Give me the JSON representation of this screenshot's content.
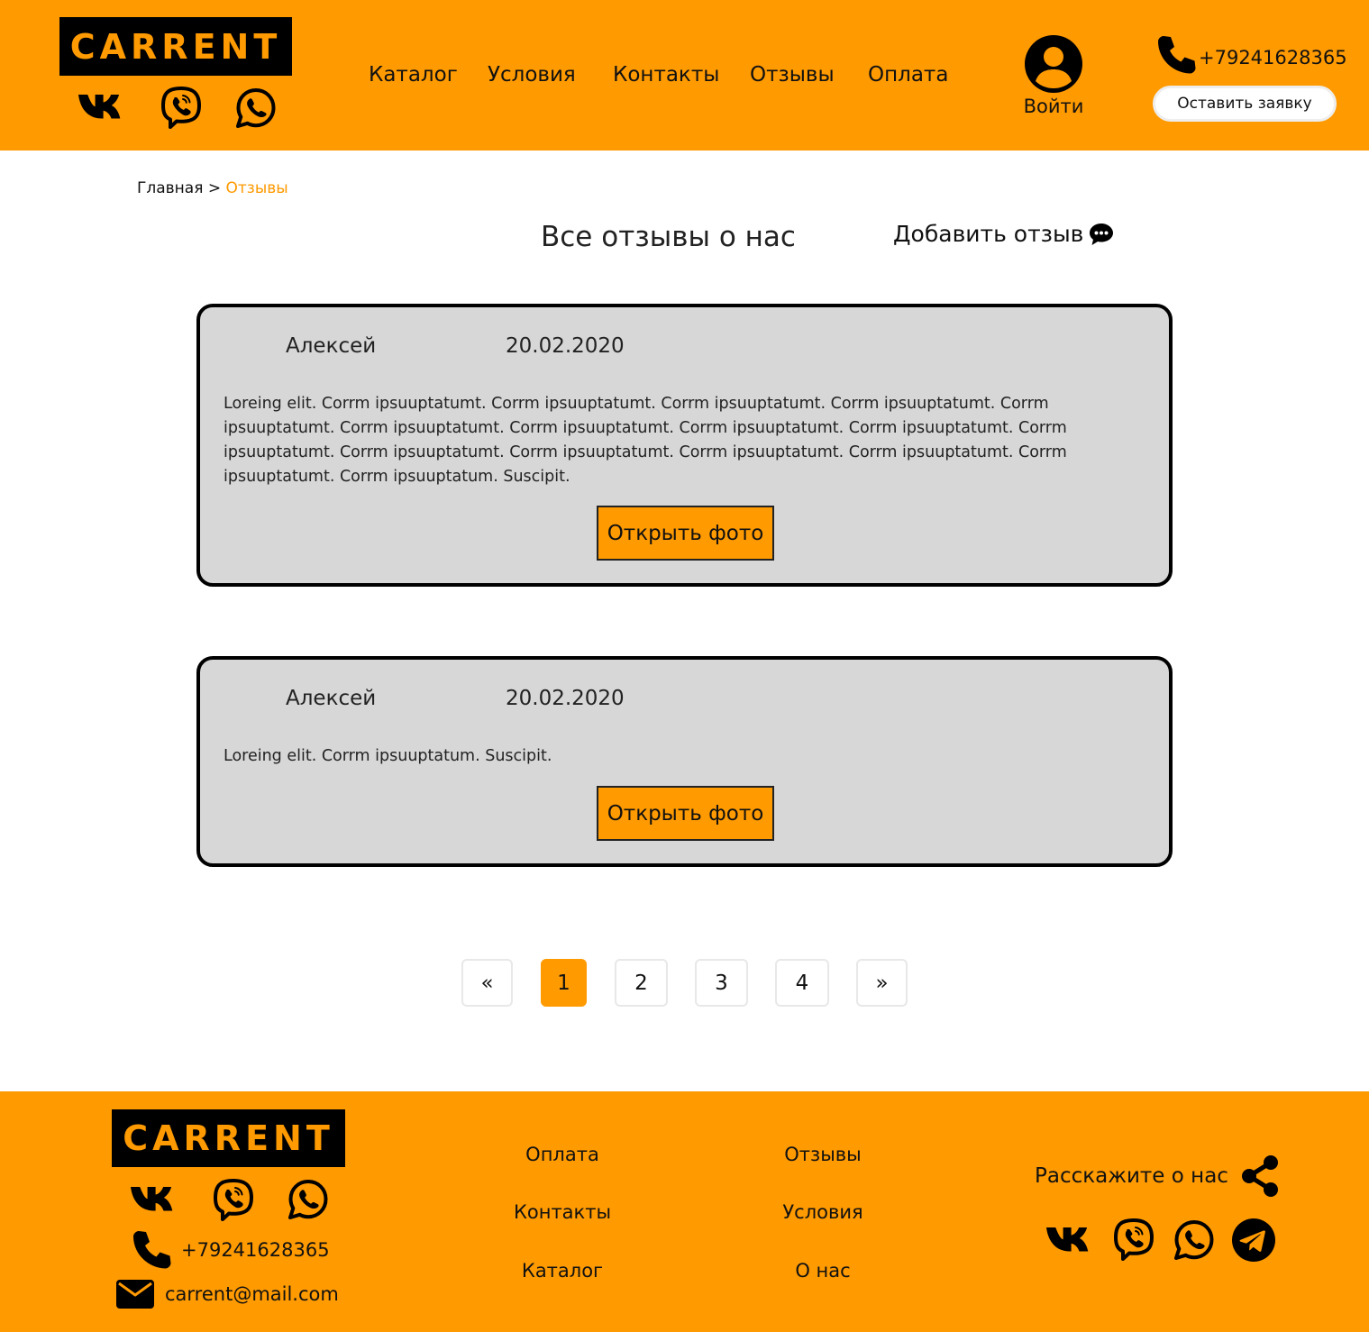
{
  "brand": {
    "logo": "CARRENT",
    "color_accent": "#FF9A00"
  },
  "header": {
    "social_icons": [
      "vk-icon",
      "viber-icon",
      "whatsapp-icon"
    ],
    "nav": [
      "Каталог",
      "Условия",
      "Контакты",
      "Отзывы",
      "Оплата"
    ],
    "login_label": "Войти",
    "phone": "+79241628365",
    "request_button": "Оставить заявку"
  },
  "breadcrumb": {
    "home": "Главная",
    "separator": ">",
    "current": "Отзывы"
  },
  "page": {
    "title": "Все отзывы о нас",
    "add_review": "Добавить отзыв"
  },
  "reviews": [
    {
      "name": "Алексей",
      "date": "20.02.2020",
      "text": "Loreing elit. Corrm ipsuuptatumt. Corrm ipsuuptatumt. Corrm ipsuuptatumt. Corrm ipsuuptatumt. Corrm ipsuuptatumt. Corrm ipsuuptatumt. Corrm ipsuuptatumt. Corrm ipsuuptatumt. Corrm ipsuuptatumt. Corrm ipsuuptatumt. Corrm ipsuuptatumt. Corrm ipsuuptatumt. Corrm ipsuuptatumt. Corrm ipsuuptatumt. Corrm ipsuuptatumt. Corrm ipsuuptatum. Suscipit.",
      "photo_button": "Открыть фото"
    },
    {
      "name": "Алексей",
      "date": "20.02.2020",
      "text": "Loreing elit. Corrm ipsuuptatum. Suscipit.",
      "photo_button": "Открыть фото"
    }
  ],
  "pagination": {
    "prev": "«",
    "pages": [
      "1",
      "2",
      "3",
      "4"
    ],
    "active": "1",
    "next": "»"
  },
  "footer": {
    "phone": "+79241628365",
    "email": "carrent@mail.com",
    "links_col1": [
      "Оплата",
      "Контакты",
      "Каталог"
    ],
    "links_col2": [
      "Отзывы",
      "Условия",
      "О нас"
    ],
    "share_label": "Расскажите о нас",
    "share_icons": [
      "vk-icon",
      "viber-icon",
      "whatsapp-icon",
      "telegram-icon"
    ]
  }
}
